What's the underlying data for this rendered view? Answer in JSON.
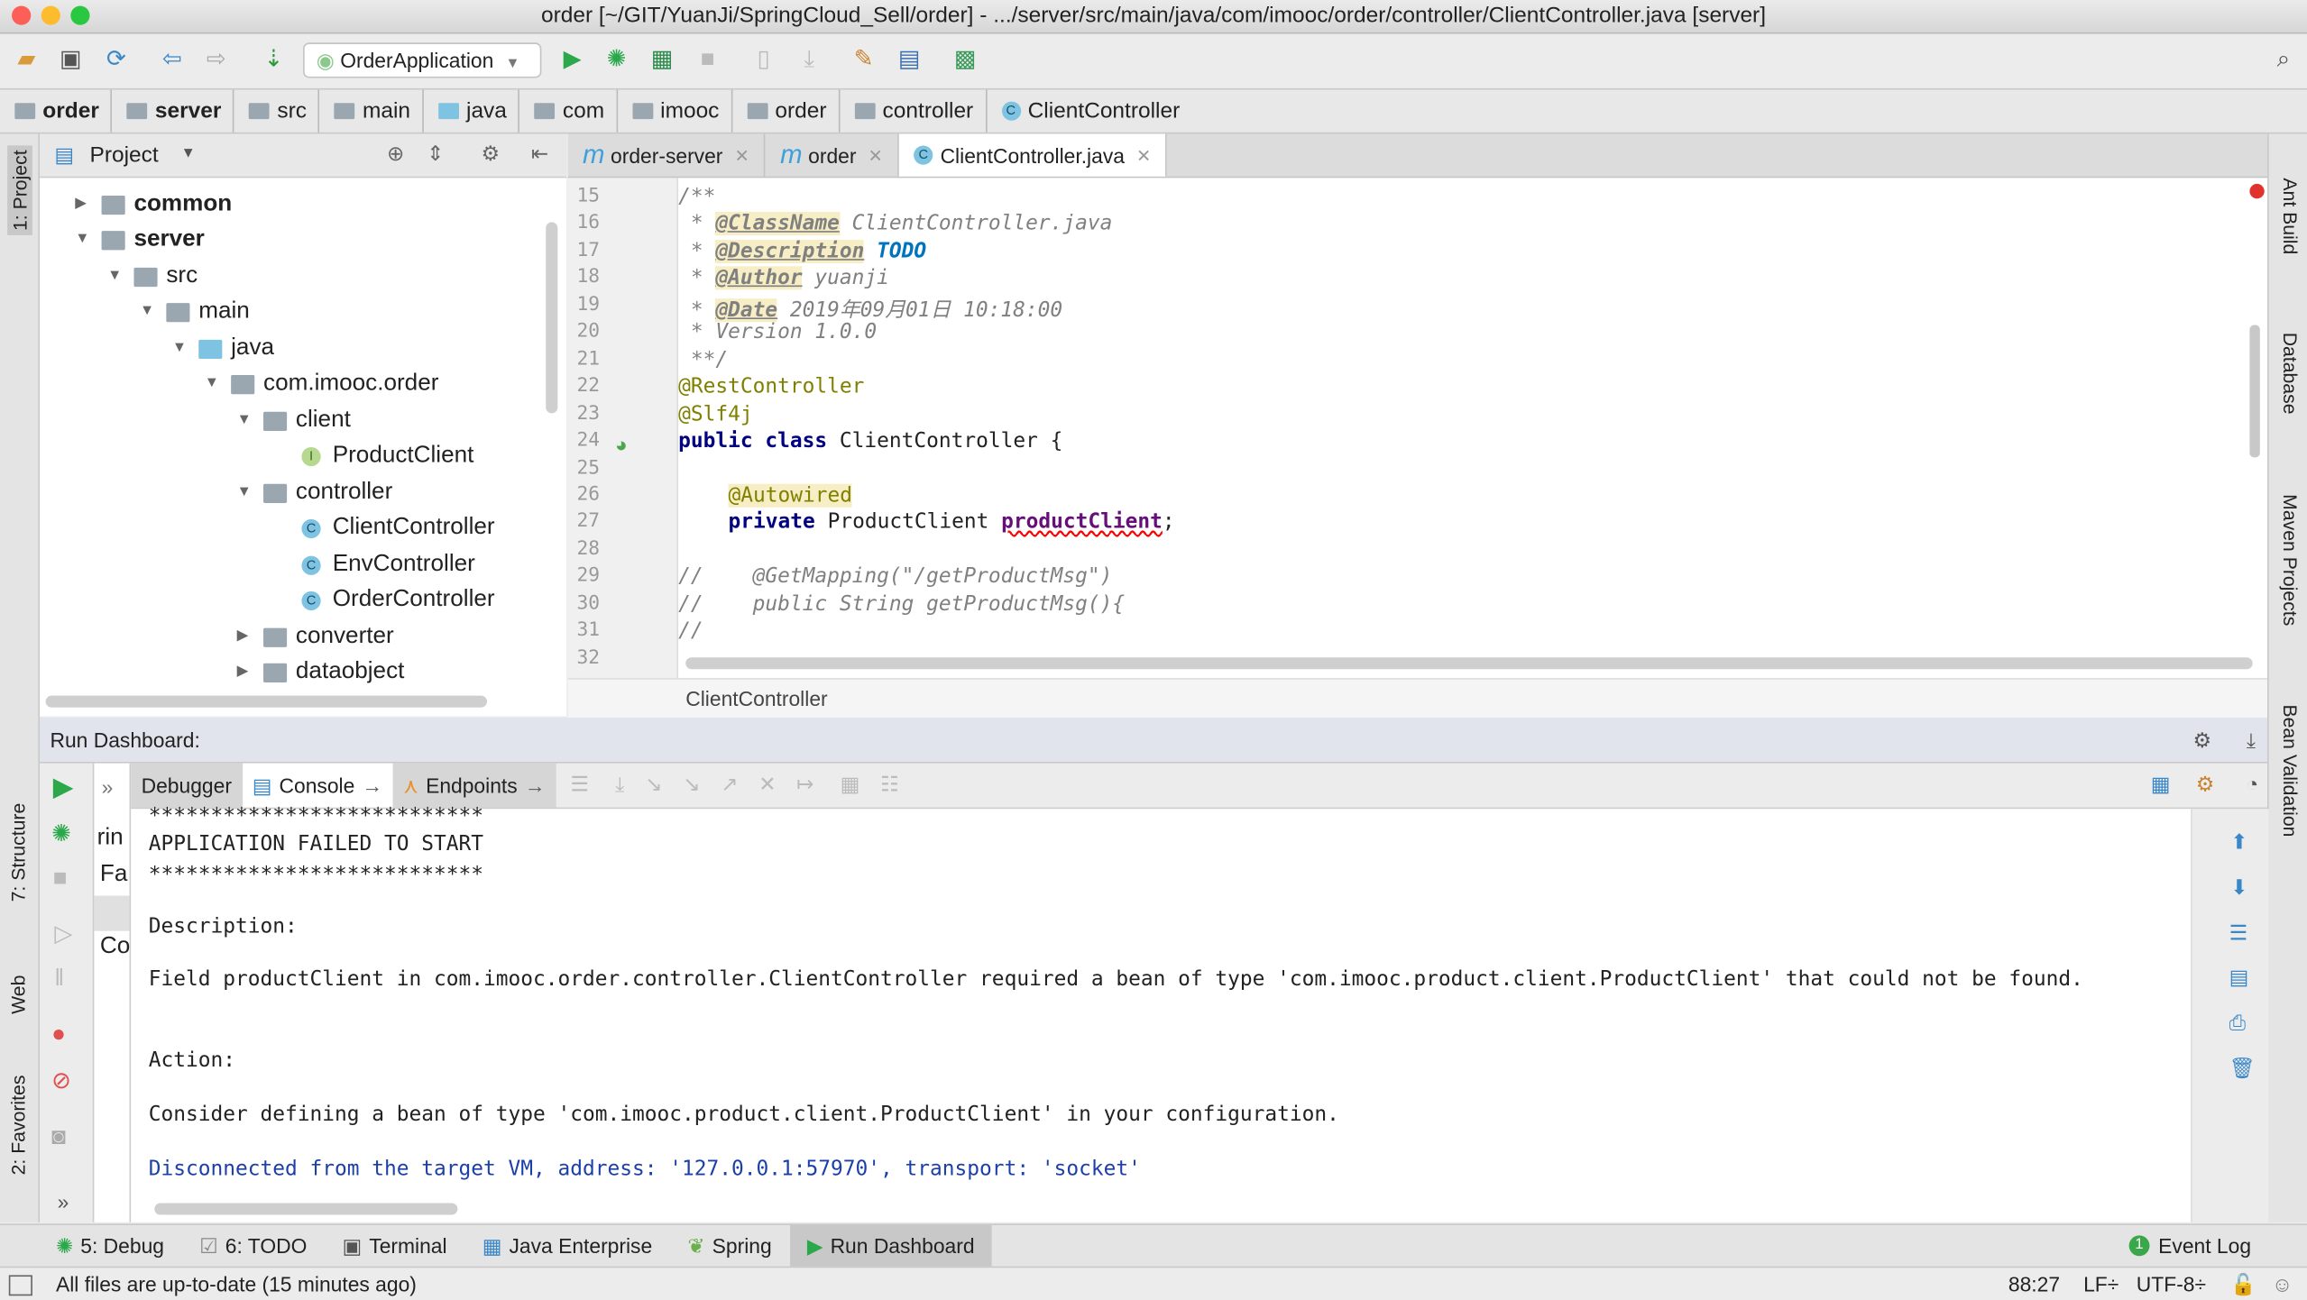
{
  "window": {
    "title": "order [~/GIT/YuanJi/SpringCloud_Sell/order] - .../server/src/main/java/com/imooc/order/controller/ClientController.java [server]"
  },
  "toolbar": {
    "run_config": "OrderApplication"
  },
  "breadcrumbs": [
    "order",
    "server",
    "src",
    "main",
    "java",
    "com",
    "imooc",
    "order",
    "controller",
    "ClientController"
  ],
  "project": {
    "title": "Project",
    "tree": [
      {
        "label": "common",
        "bold": true
      },
      {
        "label": "server",
        "bold": true
      },
      {
        "label": "src"
      },
      {
        "label": "main"
      },
      {
        "label": "java"
      },
      {
        "label": "com.imooc.order"
      },
      {
        "label": "client"
      },
      {
        "label": "ProductClient"
      },
      {
        "label": "controller"
      },
      {
        "label": "ClientController"
      },
      {
        "label": "EnvController"
      },
      {
        "label": "OrderController"
      },
      {
        "label": "converter"
      },
      {
        "label": "dataobject"
      }
    ]
  },
  "editor_tabs": [
    {
      "label": "order-server",
      "icon": "m"
    },
    {
      "label": "order",
      "icon": "m"
    },
    {
      "label": "ClientController.java",
      "icon": "C",
      "active": true
    }
  ],
  "editor": {
    "line_numbers": [
      "15",
      "16",
      "17",
      "18",
      "19",
      "20",
      "21",
      "22",
      "23",
      "24",
      "25",
      "26",
      "27",
      "28",
      "29",
      "30",
      "31",
      "32"
    ],
    "lines": {
      "l15": "/**",
      "l16a": " * ",
      "l16b": "@ClassName",
      "l16c": " ClientController.java",
      "l17a": " * ",
      "l17b": "@Description",
      "l17c": "TODO",
      "l18a": " * ",
      "l18b": "@Author",
      "l18c": " yuanji",
      "l19a": " * ",
      "l19b": "@Date",
      "l19c": " 2019年09月01日 10:18:00",
      "l20": " * Version 1.0.0",
      "l21": " **/",
      "l22": "@RestController",
      "l23": "@Slf4j",
      "l24a": "public class",
      "l24b": " ClientController {",
      "l26": "@Autowired",
      "l27a": "private",
      "l27b": " ProductClient ",
      "l27c": "productClient",
      "l27d": ";",
      "l29": "//    @GetMapping(\"/getProductMsg\")",
      "l30": "//    public String getProductMsg(){",
      "l31": "//"
    },
    "breadcrumb": "ClientController"
  },
  "run_dashboard": {
    "title": "Run Dashboard:",
    "tabs": [
      "Debugger",
      "Console",
      "Endpoints"
    ],
    "list_fragments": [
      "rin",
      "Fa",
      "Co"
    ],
    "console": [
      "***************************",
      "APPLICATION FAILED TO START",
      "***************************",
      "Description:",
      "Field productClient in com.imooc.order.controller.ClientController required a bean of type 'com.imooc.product.client.ProductClient' that could not be found.",
      "Action:",
      "Consider defining a bean of type 'com.imooc.product.client.ProductClient' in your configuration.",
      "Disconnected from the target VM, address: '127.0.0.1:57970', transport: 'socket'"
    ]
  },
  "side_tools": {
    "left": [
      "1: Project",
      "7: Structure",
      "Web",
      "2: Favorites"
    ],
    "right": [
      "Ant Build",
      "Database",
      "Maven Projects",
      "Bean Validation"
    ]
  },
  "bottom_tools": [
    {
      "label": "5: Debug"
    },
    {
      "label": "6: TODO"
    },
    {
      "label": "Terminal"
    },
    {
      "label": "Java Enterprise"
    },
    {
      "label": "Spring"
    },
    {
      "label": "Run Dashboard",
      "active": true
    }
  ],
  "event_log": {
    "count": "1",
    "label": "Event Log"
  },
  "status": {
    "message": "All files are up-to-date (15 minutes ago)",
    "position": "88:27",
    "line_sep": "LF÷",
    "encoding": "UTF-8÷"
  },
  "colors": {
    "accent": "#3ca0dc",
    "run": "#2aa84a",
    "error": "#e0332e"
  }
}
